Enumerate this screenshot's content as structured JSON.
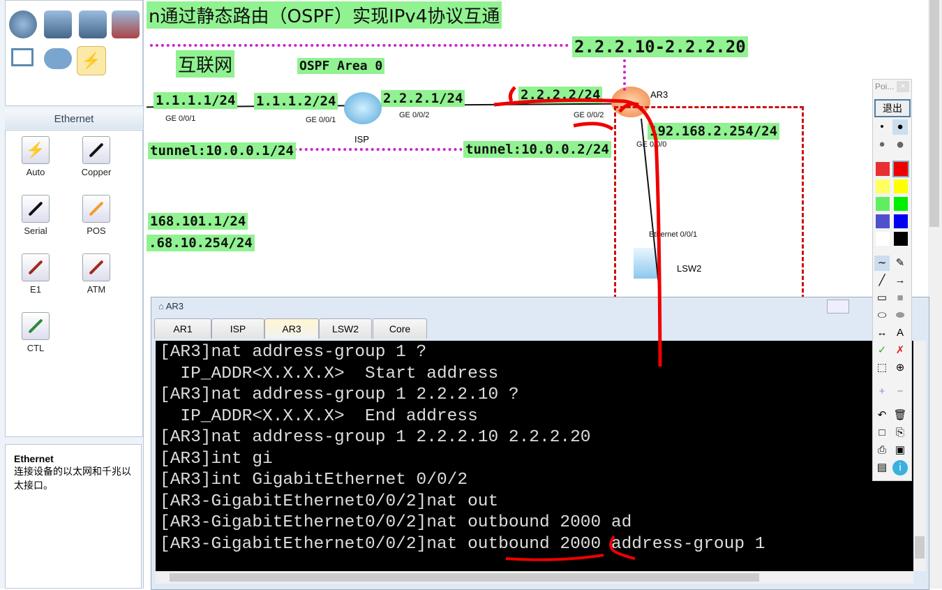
{
  "left_panel": {
    "section_title": "Ethernet",
    "cables": [
      {
        "label": "Auto",
        "color": "#000"
      },
      {
        "label": "Copper",
        "color": "#111"
      },
      {
        "label": "Serial",
        "color": "#111"
      },
      {
        "label": "POS",
        "color": "#f39c2a"
      },
      {
        "label": "E1",
        "color": "#a02a1a"
      },
      {
        "label": "ATM",
        "color": "#a02a1a"
      },
      {
        "label": "CTL",
        "color": "#2a8a3a"
      }
    ],
    "info_title": "Ethernet",
    "info_text": "连接设备的以太网和千兆以太接口。"
  },
  "topology": {
    "title": "n通过静态路由（OSPF）实现IPv4协议互通",
    "labels": {
      "internet": "互联网",
      "ospf": "OSPF Area 0",
      "pool": "2.2.2.10-2.2.2.20",
      "ip1": "1.1.1.1/24",
      "ip2": "1.1.1.2/24",
      "ip3": "2.2.2.1/24",
      "ip4": "2.2.2.2/24",
      "ip5": "192.168.2.254/24",
      "tun1": "tunnel:10.0.0.1/24",
      "tun2": "tunnel:10.0.0.2/24",
      "ip6": "168.101.1/24",
      "ip7": ".68.10.254/24"
    },
    "ports": {
      "p1": "GE 0/0/1",
      "p2": "GE 0/0/1",
      "p3": "GE 0/0/2",
      "p4": "GE 0/0/2",
      "p5": "GE 0/0/0",
      "p6": "Ethernet 0/0/1"
    },
    "devices": {
      "isp": "ISP",
      "ar3": "AR3",
      "lsw2": "LSW2"
    }
  },
  "terminal": {
    "title": "AR3",
    "tabs": [
      "AR1",
      "ISP",
      "AR3",
      "LSW2",
      "Core"
    ],
    "active_tab": "AR3",
    "lines": [
      "[AR3]nat address-group 1 ?",
      "  IP_ADDR<X.X.X.X>  Start address",
      "[AR3]nat address-group 1 2.2.2.10 ?",
      "  IP_ADDR<X.X.X.X>  End address",
      "[AR3]nat address-group 1 2.2.2.10 2.2.2.20",
      "[AR3]int gi",
      "[AR3]int GigabitEthernet 0/0/2",
      "[AR3-GigabitEthernet0/0/2]nat out",
      "[AR3-GigabitEthernet0/0/2]nat outbound 2000 ad",
      "[AR3-GigabitEthernet0/0/2]nat outbound 2000 address-group 1"
    ]
  },
  "pointer_tool": {
    "title": "Poi...",
    "exit_label": "退出",
    "colors": [
      "#e83030",
      "#ee0000",
      "#ffff60",
      "#ffff00",
      "#60ee60",
      "#00ee00",
      "#5050cc",
      "#0000ee",
      "#ffffff",
      "#000000"
    ],
    "selected_color": "#ee0000"
  }
}
